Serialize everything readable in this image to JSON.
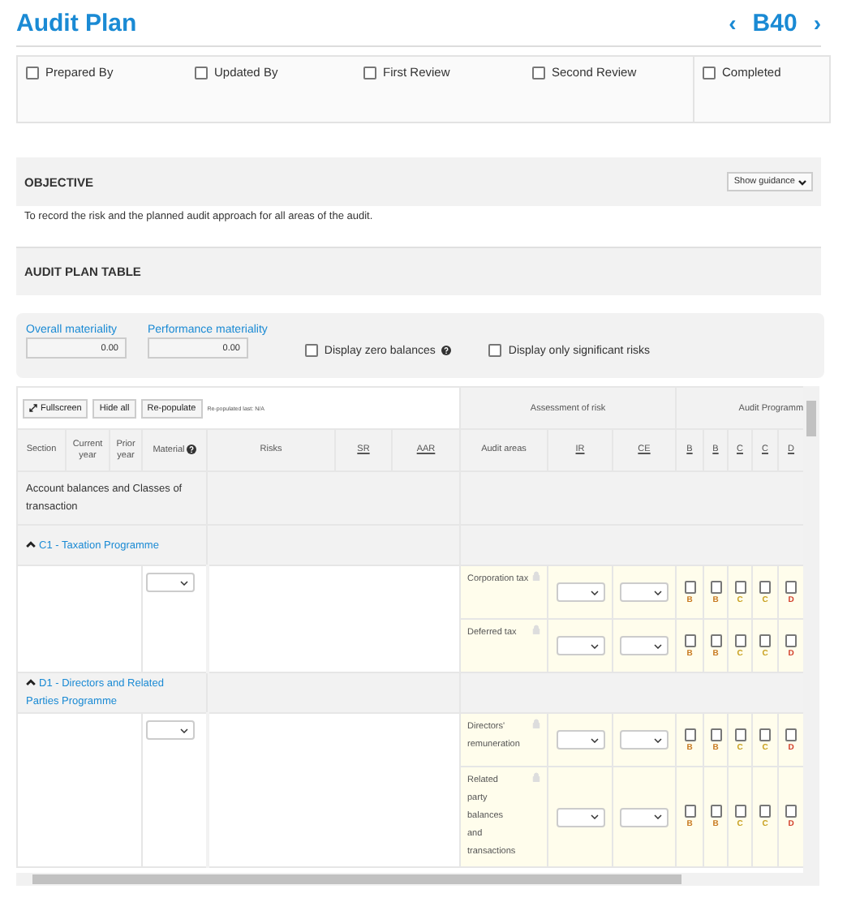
{
  "header": {
    "title": "Audit Plan",
    "prev": "‹",
    "code": "B40",
    "next": "›"
  },
  "signoffs": [
    {
      "label": "Prepared By",
      "checked": false
    },
    {
      "label": "Updated By",
      "checked": false
    },
    {
      "label": "First Review",
      "checked": false
    },
    {
      "label": "Second Review",
      "checked": false
    },
    {
      "label": "Completed",
      "checked": false
    }
  ],
  "objective": {
    "title": "OBJECTIVE",
    "guidance_button": "Show guidance",
    "text": "To record the risk and the planned audit approach for all areas of the audit."
  },
  "audit_plan_table": {
    "title": "AUDIT PLAN TABLE"
  },
  "materiality": {
    "fields": [
      {
        "label": "Overall materiality",
        "value": "0.00"
      },
      {
        "label": "Performance materiality",
        "value": "0.00"
      }
    ],
    "options": [
      {
        "label": "Display zero balances",
        "checked": false,
        "help": true
      },
      {
        "label": "Display only significant risks",
        "checked": false,
        "help": false
      }
    ]
  },
  "table": {
    "toolbar": {
      "buttons": [
        {
          "label": "Fullscreen",
          "kind": "expand"
        },
        {
          "label": "Hide all",
          "kind": "plain"
        },
        {
          "label": "Re-populate",
          "kind": "plain"
        }
      ],
      "note": "Re-populated last: N/A"
    },
    "group_headers": [
      "Assessment of risk",
      "Audit Programm"
    ],
    "columns": [
      {
        "label": "Section",
        "link": false,
        "help": false
      },
      {
        "label": "Current year",
        "link": false,
        "help": false
      },
      {
        "label": "Prior year",
        "link": false,
        "help": false
      },
      {
        "label": "Material",
        "link": false,
        "help": true
      },
      {
        "label": "Risks",
        "link": false,
        "help": false
      },
      {
        "label": "SR",
        "link": true,
        "help": false
      },
      {
        "label": "AAR",
        "link": true,
        "help": false
      },
      {
        "label": "Audit areas",
        "link": false,
        "help": false
      },
      {
        "label": "IR",
        "link": true,
        "help": false
      },
      {
        "label": "CE",
        "link": true,
        "help": false
      }
    ],
    "programme_columns": [
      "B",
      "B",
      "C",
      "C",
      "D"
    ],
    "category": "Account balances and Classes of transaction",
    "programmes": [
      {
        "title": "C1 - Taxation Programme",
        "expanded": true,
        "areas": [
          {
            "name": "Corporation tax",
            "locked": true,
            "checks": [
              {
                "checked": false,
                "letter": "B",
                "color": "#c8781e"
              },
              {
                "checked": false,
                "letter": "B",
                "color": "#c8781e"
              },
              {
                "checked": false,
                "letter": "C",
                "color": "#c8a01e"
              },
              {
                "checked": false,
                "letter": "C",
                "color": "#c8a01e"
              },
              {
                "checked": false,
                "letter": "D",
                "color": "#d23c28"
              }
            ]
          },
          {
            "name": "Deferred tax",
            "locked": true,
            "checks": [
              {
                "checked": false,
                "letter": "B",
                "color": "#c8781e"
              },
              {
                "checked": false,
                "letter": "B",
                "color": "#c8781e"
              },
              {
                "checked": false,
                "letter": "C",
                "color": "#c8a01e"
              },
              {
                "checked": false,
                "letter": "C",
                "color": "#c8a01e"
              },
              {
                "checked": false,
                "letter": "D",
                "color": "#d23c28"
              }
            ]
          }
        ]
      },
      {
        "title": "D1 - Directors and Related Parties Programme",
        "expanded": true,
        "areas": [
          {
            "name": "Directors' remuneration",
            "locked": true,
            "checks": [
              {
                "checked": false,
                "letter": "B",
                "color": "#c8781e"
              },
              {
                "checked": false,
                "letter": "B",
                "color": "#c8781e"
              },
              {
                "checked": false,
                "letter": "C",
                "color": "#c8a01e"
              },
              {
                "checked": false,
                "letter": "C",
                "color": "#c8a01e"
              },
              {
                "checked": false,
                "letter": "D",
                "color": "#d23c28"
              }
            ]
          },
          {
            "name": "Related party balances and transactions",
            "locked": true,
            "checks": [
              {
                "checked": false,
                "letter": "B",
                "color": "#c8781e"
              },
              {
                "checked": false,
                "letter": "B",
                "color": "#c8781e"
              },
              {
                "checked": false,
                "letter": "C",
                "color": "#c8a01e"
              },
              {
                "checked": false,
                "letter": "C",
                "color": "#c8a01e"
              },
              {
                "checked": false,
                "letter": "D",
                "color": "#d23c28"
              }
            ]
          }
        ]
      }
    ]
  }
}
